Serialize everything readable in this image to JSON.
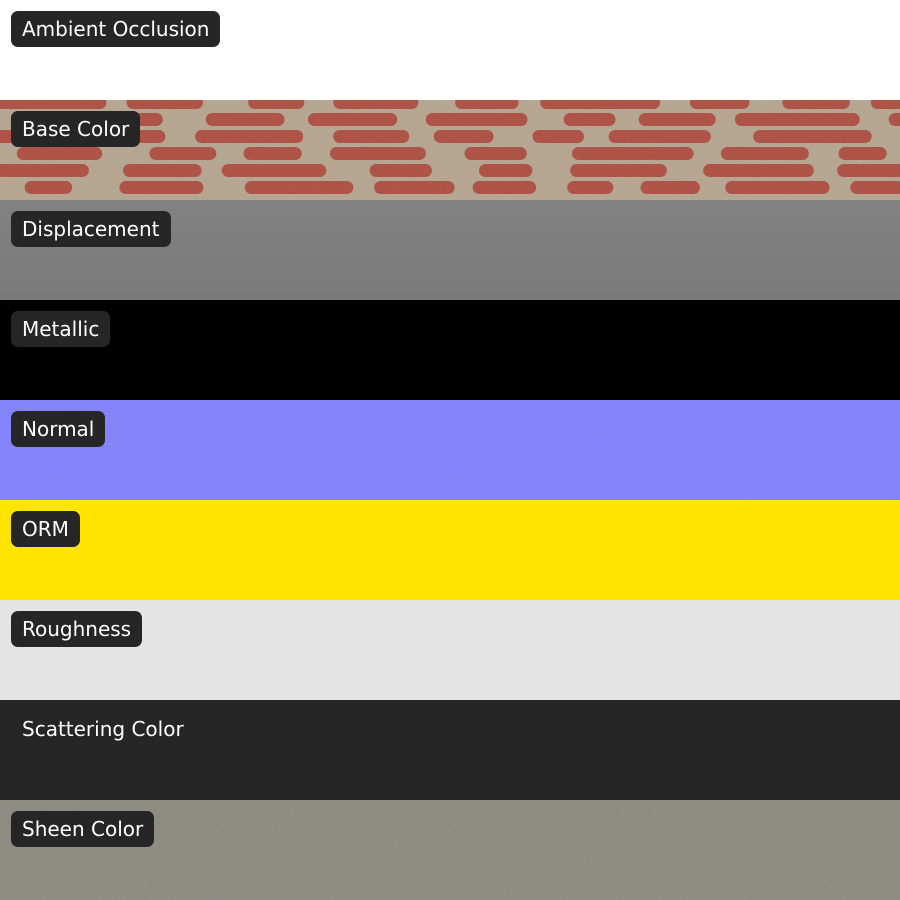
{
  "maps": [
    {
      "label": "Ambient Occlusion",
      "color": "#ffffff",
      "texture": "none"
    },
    {
      "label": "Base Color",
      "color": "#ad4a3c",
      "accent": "#b5a48e",
      "texture": "pattern"
    },
    {
      "label": "Displacement",
      "color": "#808080",
      "texture": "gradient"
    },
    {
      "label": "Metallic",
      "color": "#000000",
      "texture": "none"
    },
    {
      "label": "Normal",
      "color": "#8080ff",
      "texture": "noise"
    },
    {
      "label": "ORM",
      "color": "#ffe500",
      "texture": "none"
    },
    {
      "label": "Roughness",
      "color": "#e4e4e4",
      "texture": "none"
    },
    {
      "label": "Scattering Color",
      "color": "#262626",
      "texture": "none"
    },
    {
      "label": "Sheen Color",
      "color": "#8b8a80",
      "texture": "noise"
    }
  ]
}
